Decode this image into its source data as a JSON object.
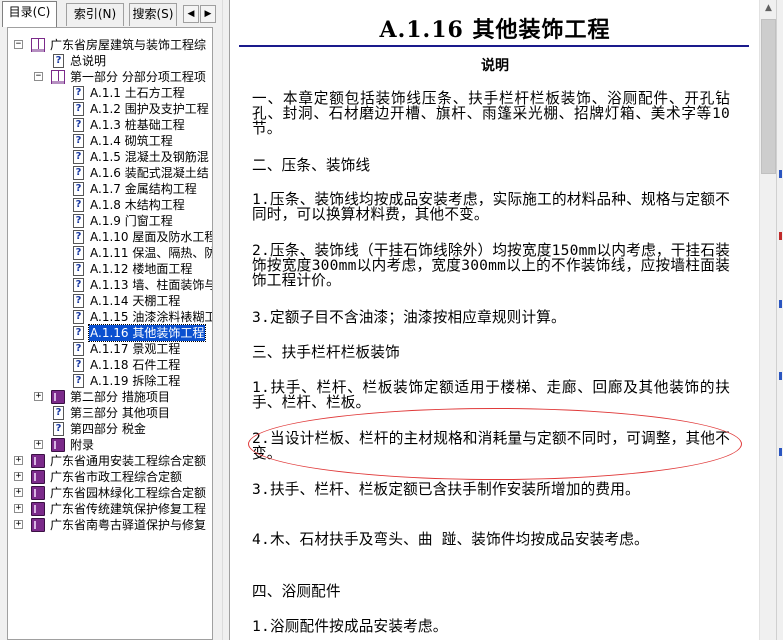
{
  "tabs": [
    {
      "label": "目录(C)",
      "active": true
    },
    {
      "label": "索引(N)",
      "active": false
    },
    {
      "label": "搜索(S)",
      "active": false
    }
  ],
  "tree": [
    {
      "label": "广东省房屋建筑与装饰工程综",
      "icon": "open-book-icon",
      "expander": "−",
      "level": 0
    },
    {
      "label": "总说明",
      "icon": "help-page-icon",
      "level": 1
    },
    {
      "label": "第一部分 分部分项工程项",
      "icon": "open-book-icon",
      "expander": "−",
      "level": 1
    },
    {
      "label": "A.1.1 土石方工程",
      "icon": "help-page-icon",
      "level": 2
    },
    {
      "label": "A.1.2 围护及支护工程",
      "icon": "help-page-icon",
      "level": 2
    },
    {
      "label": "A.1.3 桩基础工程",
      "icon": "help-page-icon",
      "level": 2
    },
    {
      "label": "A.1.4 砌筑工程",
      "icon": "help-page-icon",
      "level": 2
    },
    {
      "label": "A.1.5 混凝土及钢筋混",
      "icon": "help-page-icon",
      "level": 2
    },
    {
      "label": "A.1.6 装配式混凝土结",
      "icon": "help-page-icon",
      "level": 2
    },
    {
      "label": "A.1.7 金属结构工程",
      "icon": "help-page-icon",
      "level": 2
    },
    {
      "label": "A.1.8 木结构工程",
      "icon": "help-page-icon",
      "level": 2
    },
    {
      "label": "A.1.9 门窗工程",
      "icon": "help-page-icon",
      "level": 2
    },
    {
      "label": "A.1.10 屋面及防水工程",
      "icon": "help-page-icon",
      "level": 2
    },
    {
      "label": "A.1.11 保温、隔热、防",
      "icon": "help-page-icon",
      "level": 2
    },
    {
      "label": "A.1.12 楼地面工程",
      "icon": "help-page-icon",
      "level": 2
    },
    {
      "label": "A.1.13 墙、柱面装饰与",
      "icon": "help-page-icon",
      "level": 2
    },
    {
      "label": "A.1.14 天棚工程",
      "icon": "help-page-icon",
      "level": 2
    },
    {
      "label": "A.1.15 油漆涂料裱糊工",
      "icon": "help-page-icon",
      "level": 2
    },
    {
      "label": "A.1.16 其他装饰工程",
      "icon": "help-page-icon",
      "level": 2,
      "selected": true
    },
    {
      "label": "A.1.17 景观工程",
      "icon": "help-page-icon",
      "level": 2
    },
    {
      "label": "A.1.18 石件工程",
      "icon": "help-page-icon",
      "level": 2
    },
    {
      "label": "A.1.19 拆除工程",
      "icon": "help-page-icon",
      "level": 2
    },
    {
      "label": "第二部分 措施项目",
      "icon": "book-icon",
      "expander": "+",
      "level": 1
    },
    {
      "label": "第三部分 其他项目",
      "icon": "help-page-icon",
      "level": 1
    },
    {
      "label": "第四部分 税金",
      "icon": "help-page-icon",
      "level": 1
    },
    {
      "label": "附录",
      "icon": "book-icon",
      "expander": "+",
      "level": 1
    },
    {
      "label": "广东省通用安装工程综合定额",
      "icon": "book-icon",
      "expander": "+",
      "level": 0
    },
    {
      "label": "广东省市政工程综合定额",
      "icon": "book-icon",
      "expander": "+",
      "level": 0
    },
    {
      "label": "广东省园林绿化工程综合定额",
      "icon": "book-icon",
      "expander": "+",
      "level": 0
    },
    {
      "label": "广东省传统建筑保护修复工程",
      "icon": "book-icon",
      "expander": "+",
      "level": 0
    },
    {
      "label": "广东省南粤古驿道保护与修复",
      "icon": "book-icon",
      "expander": "+",
      "level": 0
    }
  ],
  "content": {
    "title": "A.1.16 其他装饰工程",
    "subtitle": "说明",
    "paragraphs": [
      "一、本章定额包括装饰线压条、扶手栏杆栏板装饰、浴厕配件、开孔钻孔、封洞、石材磨边开槽、旗杆、雨篷采光棚、招牌灯箱、美术字等10节。",
      "二、压条、装饰线",
      "1.压条、装饰线均按成品安装考虑，实际施工的材料品种、规格与定额不同时，可以换算材料费，其他不变。",
      "2.压条、装饰线（干挂石饰线除外）均按宽度150mm以内考虑，干挂石装饰按宽度300mm以内考虑，宽度300mm以上的不作装饰线，应按墙柱面装饰工程计价。",
      "3.定额子目不含油漆；油漆按相应章规则计算。",
      "三、扶手栏杆栏板装饰",
      "1.扶手、栏杆、栏板装饰定额适用于楼梯、走廊、回廊及其他装饰的扶手、栏杆、栏板。",
      "2.当设计栏板、栏杆的主材规格和消耗量与定额不同时，可调整，其他不变。",
      "3.扶手、栏杆、栏板定额已含扶手制作安装所增加的费用。",
      "4.木、石材扶手及弯头、曲 踫、装饰件均按成品安装考虑。",
      "四、浴厕配件",
      "1.浴厕配件按成品安装考虑。"
    ]
  }
}
